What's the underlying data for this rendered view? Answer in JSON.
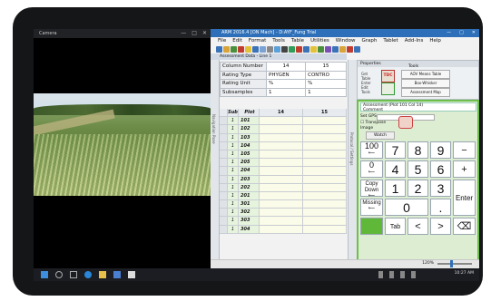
{
  "camera": {
    "title": "Camera",
    "controls": [
      "—",
      "□",
      "✕"
    ],
    "shutter_icon": "camera-shutter-icon"
  },
  "arm": {
    "title": "ARM 2016.4 [ON Mach] - D:AYF_Fung Trial",
    "window_controls": [
      "—",
      "□",
      "✕"
    ],
    "menu": [
      "File",
      "Edit",
      "Format",
      "Tools",
      "Table",
      "Utilities",
      "Window",
      "Graph",
      "Tablet",
      "Add-Ins",
      "Help"
    ],
    "tab": "Assessment Data - Line 1",
    "nav_label": "Navigation Pane",
    "side_label": "Protocol / Settings",
    "header_rows": [
      {
        "label": "Column Number",
        "a": "14",
        "b": "15"
      },
      {
        "label": "Rating Type",
        "a": "PHYGEN",
        "b": "CONTRO"
      },
      {
        "label": "Rating Unit",
        "a": "%",
        "b": "%"
      },
      {
        "label": "Subsamples",
        "a": "1",
        "b": "1"
      }
    ],
    "grid_head": {
      "sub": "Sub",
      "plot": "Plot",
      "col1": "14",
      "col2": "15"
    },
    "rows": [
      {
        "trt": "1",
        "plot": "101"
      },
      {
        "trt": "1",
        "plot": "102"
      },
      {
        "trt": "1",
        "plot": "103"
      },
      {
        "trt": "1",
        "plot": "104"
      },
      {
        "trt": "1",
        "plot": "105"
      },
      {
        "trt": "1",
        "plot": "205"
      },
      {
        "trt": "1",
        "plot": "204"
      },
      {
        "trt": "1",
        "plot": "203"
      },
      {
        "trt": "1",
        "plot": "202"
      },
      {
        "trt": "1",
        "plot": "201"
      },
      {
        "trt": "1",
        "plot": "301"
      },
      {
        "trt": "1",
        "plot": "302"
      },
      {
        "trt": "1",
        "plot": "303"
      },
      {
        "trt": "1",
        "plot": "304"
      }
    ],
    "properties": {
      "title": "Properties",
      "labels": [
        "Get",
        "Table",
        "Enter",
        "Edit",
        "Tools"
      ],
      "tdc_label": "TDC",
      "tools": "Tools",
      "btn1": "AOV Means Table",
      "btn2": "Box-Whisker",
      "btn3": "Assessment Map"
    },
    "keypad": {
      "info": "Assessment (Plot 101 Col 14)",
      "comment": "Comment",
      "set_gps": "Set GPS",
      "transpose": "Transpose",
      "image": "Image",
      "watch": "Watch",
      "keys": {
        "k100": "100",
        "k0u": "0",
        "copy": "Copy Down",
        "missing": "Missing",
        "n7": "7",
        "n8": "8",
        "n9": "9",
        "minus": "−",
        "n4": "4",
        "n5": "5",
        "n6": "6",
        "plus": "+",
        "n1": "1",
        "n2": "2",
        "n3": "3",
        "enter": "Enter",
        "n0": "0",
        "dot": ".",
        "tab": "Tab",
        "left": "<",
        "right": ">",
        "back": "⌫"
      }
    },
    "zoom_level": "120%"
  },
  "taskbar": {
    "clock": "10:27 AM"
  }
}
